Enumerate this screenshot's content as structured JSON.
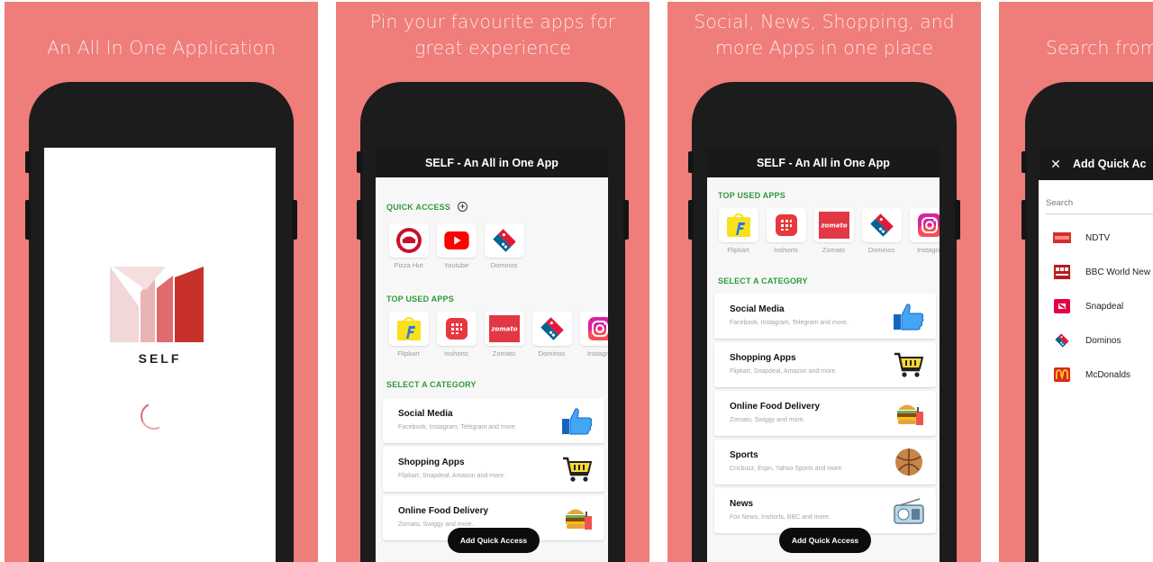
{
  "colors": {
    "panel_bg": "#ef7d79",
    "accent_green": "#2e9a3a",
    "appbar": "#191919"
  },
  "panel1": {
    "caption": "An All In One Application",
    "app_name": "SELF"
  },
  "panel2": {
    "caption_line1": "Pin your favourite apps for",
    "caption_line2": "great experience",
    "appbar_title": "SELF - An All in One App",
    "quick_access_label": "QUICK ACCESS",
    "quick_access": [
      {
        "name": "Pizza Hut",
        "icon": "pizza-hut-icon"
      },
      {
        "name": "Youtube",
        "icon": "youtube-icon"
      },
      {
        "name": "Dominos",
        "icon": "dominos-icon"
      }
    ],
    "top_used_label": "TOP USED APPS",
    "top_used": [
      {
        "name": "Flipkart",
        "icon": "flipkart-icon"
      },
      {
        "name": "Inshorts",
        "icon": "inshorts-icon"
      },
      {
        "name": "Zomato",
        "icon": "zomato-icon"
      },
      {
        "name": "Dominos",
        "icon": "dominos-icon"
      },
      {
        "name": "Instagra",
        "icon": "instagram-icon"
      }
    ],
    "category_label": "SELECT A CATEGORY",
    "categories": [
      {
        "title": "Social Media",
        "subtitle": "Facebook, Instagram, Telegram and more.",
        "icon": "thumbs-up-icon"
      },
      {
        "title": "Shopping Apps",
        "subtitle": "Flipkart, Snapdeal, Amazon and more.",
        "icon": "cart-icon"
      },
      {
        "title": "Online Food Delivery",
        "subtitle": "Zomato, Swiggy and more.",
        "icon": "burger-icon"
      }
    ],
    "fab_label": "Add Quick Access"
  },
  "panel3": {
    "caption_line1": "Social, News, Shopping, and",
    "caption_line2": "more Apps in one place",
    "appbar_title": "SELF - An All in One App",
    "top_used_label": "TOP USED APPS",
    "top_used": [
      {
        "name": "Flipkart",
        "icon": "flipkart-icon"
      },
      {
        "name": "Inshorts",
        "icon": "inshorts-icon"
      },
      {
        "name": "Zomato",
        "icon": "zomato-icon"
      },
      {
        "name": "Dominos",
        "icon": "dominos-icon"
      },
      {
        "name": "Instagra",
        "icon": "instagram-icon"
      }
    ],
    "category_label": "SELECT A CATEGORY",
    "categories": [
      {
        "title": "Social Media",
        "subtitle": "Facebook, Instagram, Telegram and more.",
        "icon": "thumbs-up-icon"
      },
      {
        "title": "Shopping Apps",
        "subtitle": "Flipkart, Snapdeal, Amazon and more.",
        "icon": "cart-icon"
      },
      {
        "title": "Online Food Delivery",
        "subtitle": "Zomato, Swiggy and more.",
        "icon": "burger-icon"
      },
      {
        "title": "Sports",
        "subtitle": "Cricbuzz, Espn, Yahoo Sports and more.",
        "icon": "ball-icon"
      },
      {
        "title": "News",
        "subtitle": "Fox News, Inshorts, BBC and more.",
        "icon": "radio-icon"
      }
    ],
    "fab_label": "Add Quick Access"
  },
  "panel4": {
    "caption": "Search from",
    "bar_title": "Add Quick Ac",
    "search_placeholder": "Search",
    "results": [
      {
        "name": "NDTV",
        "icon": "ndtv-icon"
      },
      {
        "name": "BBC World New",
        "icon": "bbc-icon"
      },
      {
        "name": "Snapdeal",
        "icon": "snapdeal-icon"
      },
      {
        "name": "Dominos",
        "icon": "dominos-icon"
      },
      {
        "name": "McDonalds",
        "icon": "mcdonalds-icon"
      }
    ]
  }
}
